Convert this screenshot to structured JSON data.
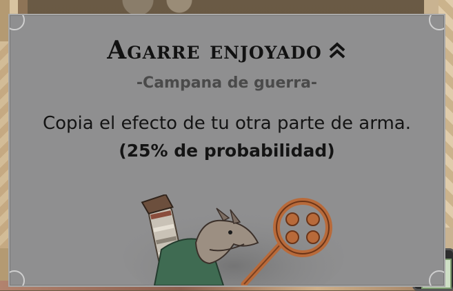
{
  "tooltip": {
    "title": "Agarre enjoyado",
    "rank_icon": "double-chevron-up-icon",
    "subtitle": "-Campana de guerra-",
    "description": "Copia el efecto de tu otra parte de arma.",
    "chance": "(25% de probabilidad)",
    "artwork": "lizard-warrior-with-ring-staff"
  },
  "colors": {
    "card_bg": "#8f8f90",
    "title": "#121212",
    "subtitle": "#4a4a4a",
    "staff": "#b86a3a"
  }
}
